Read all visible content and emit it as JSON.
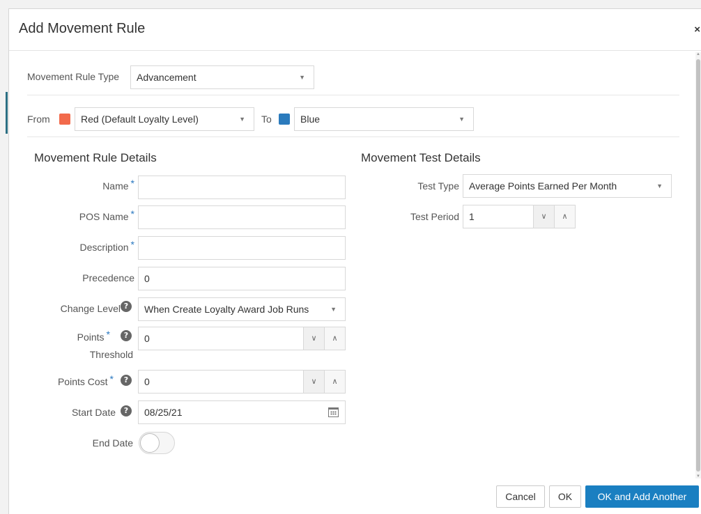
{
  "dialog": {
    "title": "Add Movement Rule",
    "close_glyph": "×"
  },
  "rule_type": {
    "label": "Movement Rule Type",
    "value": "Advancement"
  },
  "levels": {
    "from_label": "From",
    "from_value": "Red (Default Loyalty Level)",
    "from_color": "#f26a4b",
    "to_label": "To",
    "to_value": "Blue",
    "to_color": "#2b7bbd"
  },
  "rule_details": {
    "title": "Movement Rule Details",
    "name_label": "Name",
    "name_value": "",
    "pos_name_label": "POS Name",
    "pos_name_value": "",
    "description_label": "Description",
    "description_value": "",
    "precedence_label": "Precedence",
    "precedence_value": "0",
    "change_level_label": "Change Level",
    "change_level_value": "When Create Loyalty Award Job Runs",
    "points_threshold_label_1": "Points",
    "points_threshold_label_2": "Threshold",
    "points_threshold_value": "0",
    "points_cost_label": "Points Cost",
    "points_cost_value": "0",
    "start_date_label": "Start Date",
    "start_date_value": "08/25/21",
    "end_date_label": "End Date",
    "end_date_enabled": false,
    "required_mark": "*",
    "help_glyph": "?"
  },
  "test_details": {
    "title": "Movement Test Details",
    "test_type_label": "Test Type",
    "test_type_value": "Average Points Earned Per Month",
    "test_period_label": "Test Period",
    "test_period_value": "1"
  },
  "icons": {
    "dropdown_arrow": "▼",
    "spinner_down": "∨",
    "spinner_up": "∧"
  },
  "footer": {
    "cancel_label": "Cancel",
    "ok_label": "OK",
    "ok_add_another_label": "OK and Add Another"
  },
  "colors": {
    "primary": "#1a7fc1",
    "required": "#2a78c0"
  }
}
